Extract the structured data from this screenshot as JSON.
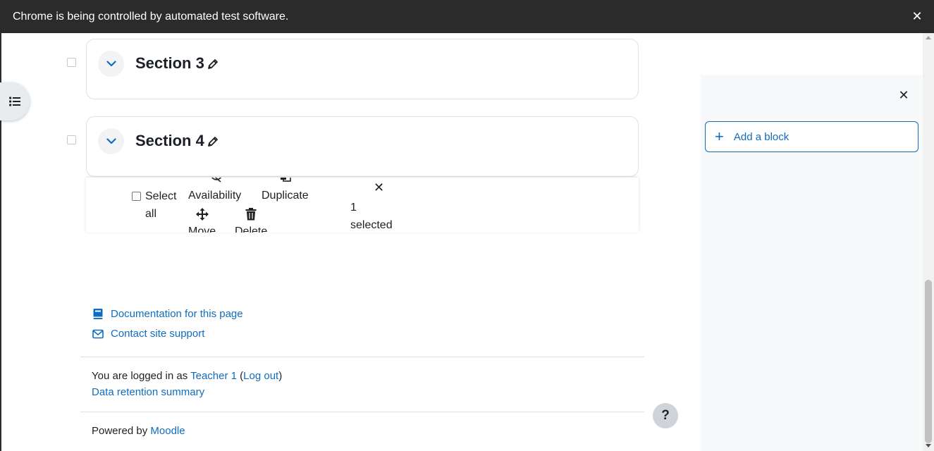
{
  "browser": {
    "infobar_text": "Chrome is being controlled by automated test software.",
    "close_glyph": "✕"
  },
  "sections": [
    {
      "title": "Section 3"
    },
    {
      "title": "Section 4"
    }
  ],
  "bulk_edit": {
    "select_all_line1": "Select",
    "select_all_line2": "all",
    "availability_label": "Availability",
    "duplicate_label": "Duplicate",
    "move_label": "Move",
    "delete_label": "Delete",
    "count": "1",
    "selected_label": "selected",
    "close_glyph": "✕"
  },
  "footer": {
    "documentation_link": "Documentation for this page",
    "contact_link": "Contact site support",
    "logged_in_prefix": "You are logged in as ",
    "user_name": "Teacher 1",
    "paren_open": " (",
    "logout_link": "Log out",
    "paren_close": ")",
    "data_retention_link": "Data retention summary",
    "powered_by_prefix": "Powered by ",
    "moodle_link": "Moodle",
    "help_glyph": "?"
  },
  "block_drawer": {
    "close_glyph": "✕",
    "add_block_label": "Add a block",
    "add_glyph": "+"
  },
  "colors": {
    "link": "#0f6cbf",
    "infobar": "#2b2b2b",
    "drawer_bg": "#f8f9fa"
  }
}
